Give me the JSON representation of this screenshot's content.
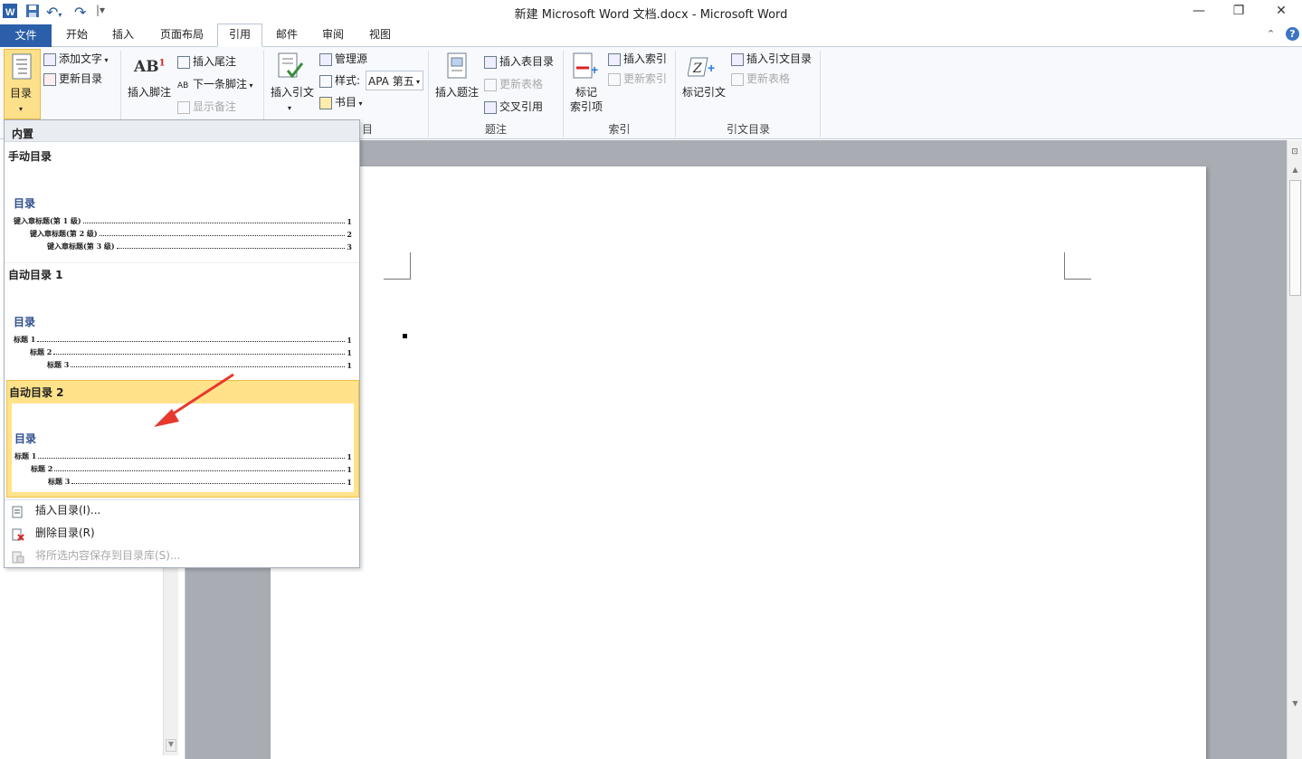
{
  "window": {
    "title": "新建 Microsoft Word 文档.docx - Microsoft Word",
    "controls": {
      "minimize": "—",
      "restore": "❐",
      "close": "✕"
    }
  },
  "qat": {
    "undo_label": "↶",
    "redo_label": "↷"
  },
  "tabs": [
    {
      "label": "文件"
    },
    {
      "label": "开始"
    },
    {
      "label": "插入"
    },
    {
      "label": "页面布局"
    },
    {
      "label": "引用"
    },
    {
      "label": "邮件"
    },
    {
      "label": "审阅"
    },
    {
      "label": "视图"
    }
  ],
  "ribbon": {
    "toc_group": {
      "toc_button": "目录",
      "add_text": "添加文字",
      "update_toc": "更新目录"
    },
    "footnote_group": {
      "insert_footnote": "插入脚注",
      "insert_endnote": "插入尾注",
      "next_footnote": "下一条脚注",
      "show_notes": "显示备注"
    },
    "citation_group": {
      "insert_citation": "插入引文",
      "manage_sources": "管理源",
      "style_label": "样式:",
      "style_value": "APA 第五",
      "bibliography": "书目",
      "group_label": "引文与书目",
      "group_label_visible": "目"
    },
    "caption_group": {
      "insert_caption": "插入题注",
      "insert_table_of_figures": "插入表目录",
      "update_table": "更新表格",
      "cross_reference": "交叉引用",
      "label": "题注"
    },
    "index_group": {
      "mark_entry_line1": "标记",
      "mark_entry_line2": "索引项",
      "insert_index": "插入索引",
      "update_index": "更新索引",
      "label": "索引"
    },
    "authorities_group": {
      "mark_citation": "标记引文",
      "insert_toa": "插入引文目录",
      "update_table": "更新表格",
      "label": "引文目录"
    }
  },
  "dropdown": {
    "header": "内置",
    "galleries": [
      {
        "title": "手动目录",
        "toc_heading": "目录",
        "lines": [
          {
            "text": "键入章标题(第 1 级)",
            "page": "1",
            "indent": 0
          },
          {
            "text": "键入章标题(第 2 级)",
            "page": "2",
            "indent": 1
          },
          {
            "text": "键入章标题(第 3 级)",
            "page": "3",
            "indent": 2
          }
        ]
      },
      {
        "title": "自动目录 1",
        "toc_heading": "目录",
        "lines": [
          {
            "text": "标题 1",
            "page": "1",
            "indent": 0
          },
          {
            "text": "标题 2",
            "page": "1",
            "indent": 1
          },
          {
            "text": "标题 3",
            "page": "1",
            "indent": 2
          }
        ]
      },
      {
        "title": "自动目录 2",
        "toc_heading": "目录",
        "lines": [
          {
            "text": "标题 1",
            "page": "1",
            "indent": 0
          },
          {
            "text": "标题 2",
            "page": "1",
            "indent": 1
          },
          {
            "text": "标题 3",
            "page": "1",
            "indent": 2
          }
        ]
      }
    ],
    "menu": {
      "insert_toc": "插入目录(I)...",
      "remove_toc": "删除目录(R)",
      "save_selection": "将所选内容保存到目录库(S)..."
    }
  },
  "colors": {
    "file_tab": "#2b5faa",
    "toc_heading": "#2f4f8f",
    "selected_gallery": "#ffe28a",
    "arrow": "#e8392f"
  }
}
